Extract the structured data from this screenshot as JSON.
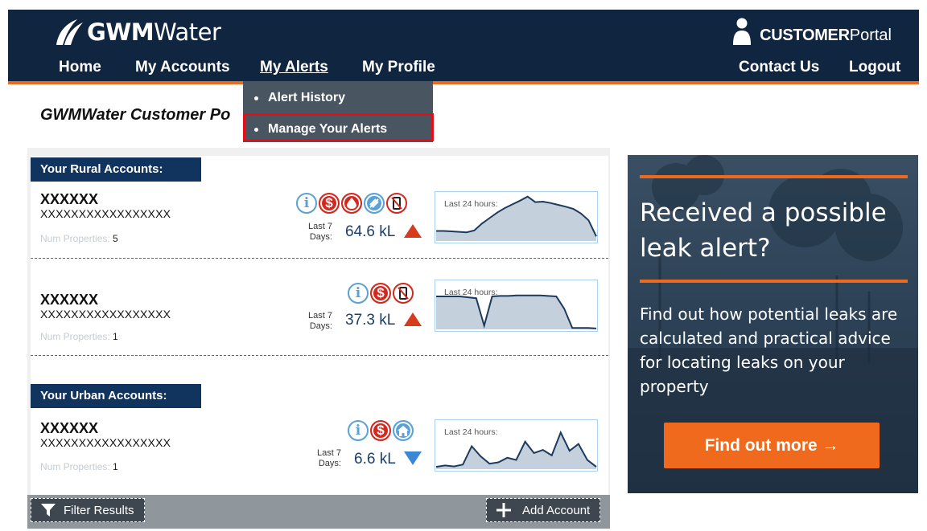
{
  "header": {
    "logo_bold": "GWM",
    "logo_light": "Water",
    "portal_bold": "CUSTOMER",
    "portal_light": "Portal"
  },
  "nav": {
    "home": "Home",
    "accounts": "My Accounts",
    "alerts": "My Alerts",
    "profile": "My Profile",
    "contact": "Contact Us",
    "logout": "Logout"
  },
  "alerts_menu": {
    "items": [
      {
        "label": "Alert History"
      },
      {
        "label": "Manage Your Alerts",
        "highlighted": true
      }
    ]
  },
  "page": {
    "heading": "GWMWater Customer Po"
  },
  "rural": {
    "label": "Your Rural Accounts:",
    "accounts": [
      {
        "name": "XXXXXX",
        "number": "XXXXXXXXXXXXXXXXX",
        "props_label": "Num Properties:",
        "props_value": "5",
        "last7_a": "Last 7",
        "last7_b": "Days:",
        "usage": "64.6 kL",
        "trend": "up",
        "icons": [
          "info-icon",
          "dollar-icon",
          "leak-drop-icon",
          "meter-icon",
          "no-mobile-icon"
        ],
        "spark_label": "Last 24 hours:",
        "spark": [
          0.22,
          0.22,
          0.21,
          0.2,
          0.19,
          0.23,
          0.38,
          0.5,
          0.62,
          0.72,
          0.8,
          0.88,
          0.97,
          0.85,
          0.86,
          0.83,
          0.79,
          0.75,
          0.7,
          0.6,
          0.45,
          0.1
        ]
      },
      {
        "name": "XXXXXX",
        "number": "XXXXXXXXXXXXXXXXX",
        "props_label": "Num Properties:",
        "props_value": "1",
        "last7_a": "Last 7",
        "last7_b": "Days:",
        "usage": "37.3 kL",
        "trend": "up",
        "icons": [
          "info-icon",
          "dollar-icon",
          "no-mobile-icon"
        ],
        "spark_label": "Last 24 hours:",
        "spark": [
          0.72,
          0.72,
          0.72,
          0.72,
          0.7,
          0.68,
          0.08,
          0.72,
          0.73,
          0.73,
          0.74,
          0.74,
          0.74,
          0.74,
          0.73,
          0.72,
          0.45,
          0.03,
          0.03,
          0.03,
          0.02
        ]
      }
    ]
  },
  "urban": {
    "label": "Your Urban Accounts:",
    "accounts": [
      {
        "name": "XXXXXX",
        "number": "XXXXXXXXXXXXXXXXX",
        "props_label": "Num Properties:",
        "props_value": "1",
        "last7_a": "Last 7",
        "last7_b": "Days:",
        "usage": "6.6 kL",
        "trend": "down",
        "icons": [
          "info-icon",
          "dollar-icon",
          "home-icon"
        ],
        "spark_label": "Last 24 hours:",
        "spark": [
          0.05,
          0.08,
          0.06,
          0.1,
          0.5,
          0.28,
          0.12,
          0.15,
          0.25,
          0.2,
          0.6,
          0.35,
          0.42,
          0.3,
          0.8,
          0.4,
          0.55,
          0.2,
          0.05
        ]
      }
    ]
  },
  "footer": {
    "filter": "Filter Results",
    "add": "Add Account"
  },
  "promo": {
    "title": "Received a possible leak alert?",
    "text": "Find out how potential leaks are calculated and practical advice for locating leaks on your property",
    "button": "Find out more →"
  }
}
